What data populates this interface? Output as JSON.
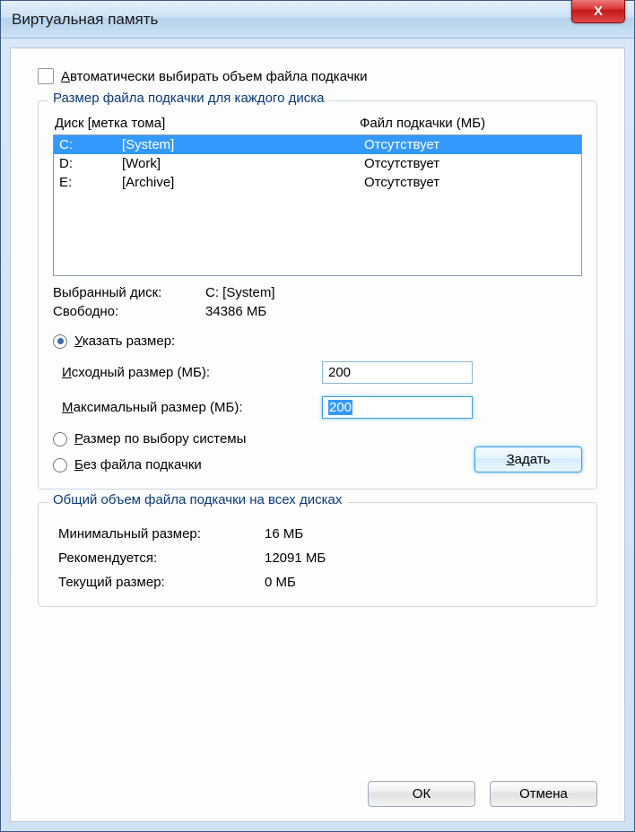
{
  "window": {
    "title": "Виртуальная память",
    "close_icon": "X"
  },
  "auto": {
    "underline_prefix": "А",
    "label_rest": "втоматически выбирать объем файла подкачки",
    "checked": false
  },
  "perDisk": {
    "legend": "Размер файла подкачки для каждого диска",
    "header_drive_underline": "Д",
    "header_drive_rest": "иск [метка тома]",
    "header_pf": "Файл подкачки (МБ)",
    "rows": [
      {
        "drive": "C:",
        "label": "[System]",
        "pf": "Отсутствует",
        "selected": true
      },
      {
        "drive": "D:",
        "label": "[Work]",
        "pf": "Отсутствует",
        "selected": false
      },
      {
        "drive": "E:",
        "label": "[Archive]",
        "pf": "Отсутствует",
        "selected": false
      }
    ],
    "selected_label": "Выбранный диск:",
    "selected_value": "C:  [System]",
    "free_label": "Свободно:",
    "free_value": "34386 МБ",
    "radio_custom_underline": "У",
    "radio_custom_rest": "казать размер:",
    "initial_underline": "И",
    "initial_rest": "сходный размер (МБ):",
    "initial_value": "200",
    "max_underline": "М",
    "max_rest": "аксимальный размер (МБ):",
    "max_value": "200",
    "radio_system_underline": "Р",
    "radio_system_rest": "азмер по выбору системы",
    "radio_none_underline": "Б",
    "radio_none_rest": "ез файла подкачки",
    "set_underline": "З",
    "set_rest": "адать",
    "size_mode": "custom"
  },
  "totals": {
    "legend": "Общий объем файла подкачки на всех дисках",
    "min_label": "Минимальный размер:",
    "min_value": "16 МБ",
    "rec_label": "Рекомендуется:",
    "rec_value": "12091 МБ",
    "cur_label": "Текущий размер:",
    "cur_value": "0 МБ"
  },
  "buttons": {
    "ok": "ОК",
    "cancel": "Отмена"
  }
}
